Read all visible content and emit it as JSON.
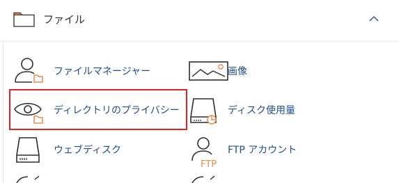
{
  "section": {
    "title": "ファイル",
    "collapse_icon": "chevron-up-icon"
  },
  "tools": {
    "file_manager": {
      "label": "ファイルマネージャー",
      "icon": "user-folder-icon"
    },
    "images": {
      "label": "画像",
      "icon": "image-icon"
    },
    "directory_privacy": {
      "label": "ディレクトリのプライバシー",
      "icon": "eye-folder-icon"
    },
    "disk_usage": {
      "label": "ディスク使用量",
      "icon": "disk-chart-icon"
    },
    "web_disk": {
      "label": "ウェブディスク",
      "icon": "disk-icon"
    },
    "ftp_accounts": {
      "label": "FTP アカウント",
      "icon": "user-ftp-icon",
      "icon_text": "FTP"
    }
  },
  "colors": {
    "icon_stroke": "#2d2d2d",
    "accent_orange": "#f08a4b",
    "link_blue": "#1f4d8f",
    "highlight_red": "#e02424"
  }
}
